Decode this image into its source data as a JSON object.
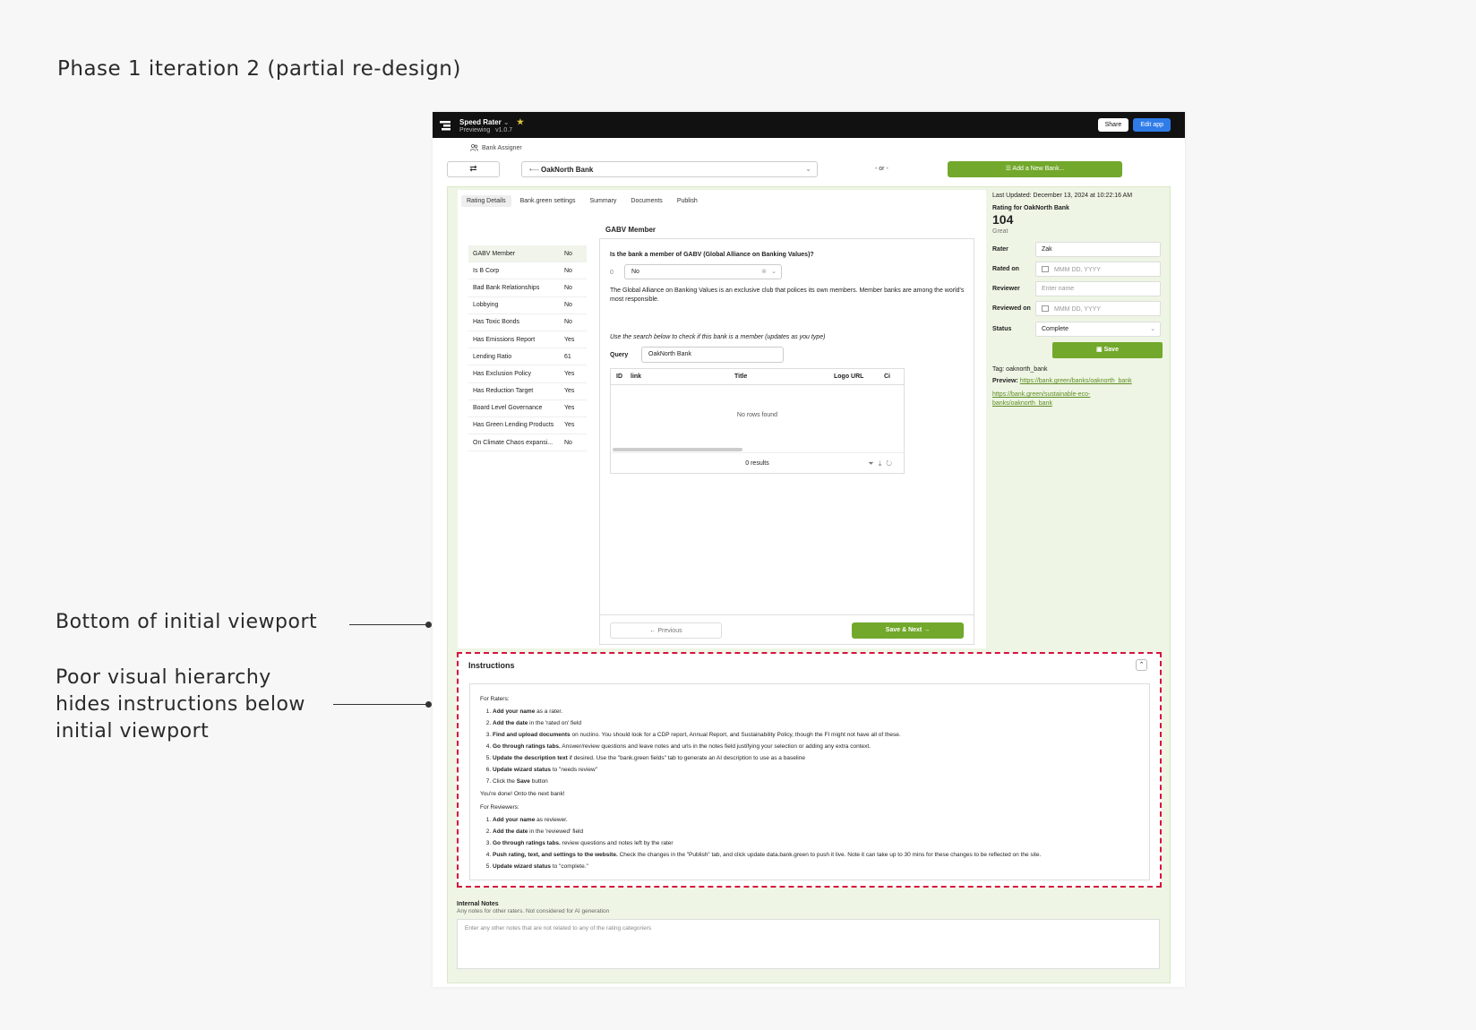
{
  "annotations": {
    "heading": "Phase 1 iteration 2 (partial re-design)",
    "viewport_note": "Bottom of initial viewport",
    "hierarchy_note_lines": [
      "Poor visual hierarchy",
      "hides instructions below",
      "initial viewport"
    ]
  },
  "topbar": {
    "app_name": "Speed Rater",
    "previewing": "Previewing",
    "version": "v1.0.7",
    "share_label": "Share",
    "edit_label": "Edit app"
  },
  "assigner_label": "Bank Assigner",
  "bank_row": {
    "selected_bank": "OakNorth Bank",
    "or_text": "- or -",
    "add_bank_label": "Add a New Bank..."
  },
  "tabs": [
    "Rating Details",
    "Bank.green settings",
    "Summary",
    "Documents",
    "Publish"
  ],
  "questions": [
    {
      "label": "GABV Member",
      "value": "No"
    },
    {
      "label": "Is B Corp",
      "value": "No"
    },
    {
      "label": "Bad Bank Relationships",
      "value": "No"
    },
    {
      "label": "Lobbying",
      "value": "No"
    },
    {
      "label": "Has Toxic Bonds",
      "value": "No"
    },
    {
      "label": "Has Emissions Report",
      "value": "Yes"
    },
    {
      "label": "Lending Ratio",
      "value": "61"
    },
    {
      "label": "Has Exclusion Policy",
      "value": "Yes"
    },
    {
      "label": "Has Reduction Target",
      "value": "Yes"
    },
    {
      "label": "Board Level Governance",
      "value": "Yes"
    },
    {
      "label": "Has Green Lending Products",
      "value": "Yes"
    },
    {
      "label": "On Climate Chaos expansi...",
      "value": "No"
    }
  ],
  "card": {
    "title": "GABV Member",
    "question": "Is the bank a member of GABV (Global Alliance on Banking Values)?",
    "score": "0",
    "answer": "No",
    "description": "The Global Alliance on Banking Values is an exclusive club that polices its own members. Member banks are among the world's most responsible.",
    "search_hint": "Use the search below to check if this bank is a member (updates as you type)",
    "query_label": "Query",
    "query_value": "OakNorth Bank",
    "table_columns": [
      "ID",
      "link",
      "Title",
      "Logo URL",
      "Ci"
    ],
    "empty_text": "No rows found",
    "results_text": "0 results",
    "prev_label": "Previous",
    "next_label": "Save & Next"
  },
  "rating": {
    "last_updated": "Last Updated: December 13, 2024 at 10:22:16 AM",
    "rating_for": "Rating for OakNorth Bank",
    "score": "104",
    "grade": "Great",
    "rater_label": "Rater",
    "rater_value": "Zak",
    "rated_on_label": "Rated on",
    "date_placeholder": "MMM DD, YYYY",
    "reviewer_label": "Reviewer",
    "reviewer_placeholder": "Enter name",
    "reviewed_on_label": "Reviewed on",
    "status_label": "Status",
    "status_value": "Complete",
    "save_label": "Save",
    "tag": "Tag: oaknorth_bank",
    "preview_label": "Preview:",
    "preview_link": "https://bank.green/banks/oaknorth_bank",
    "second_link": "https://bank.green/sustainable-eco-banks/oaknorth_bank"
  },
  "instructions": {
    "title": "Instructions",
    "raters_heading": "For Raters:",
    "raters_steps": [
      {
        "b": "Add your name",
        "t": " as a rater."
      },
      {
        "b": "Add the date",
        "t": " in the 'rated on' field"
      },
      {
        "b": "Find and upload documents",
        "t": " on nuclino. You should look for a CDP report, Annual Report, and Sustainability Policy, though the FI might not have all of these."
      },
      {
        "b": "Go through ratings tabs.",
        "t": " Answer/review questions and leave notes and urls in the notes field justifying your selection or adding any extra context."
      },
      {
        "b": "Update the description text",
        "t": " if desired. Use the \"bank.green fields\" tab to generate an AI description to use as a baseline"
      },
      {
        "b": "Update wizard status",
        "t": " to \"needs review\""
      },
      {
        "p": "Click the ",
        "b": "Save",
        "t": " button"
      }
    ],
    "done_text": "You're done! Onto the next bank!",
    "reviewers_heading": "For Reviewers:",
    "reviewers_steps": [
      {
        "b": "Add your name",
        "t": " as reviewer."
      },
      {
        "b": "Add the date",
        "t": " in the 'reviewed' field"
      },
      {
        "b": "Go through ratings tabs.",
        "t": " review questions and notes left by the rater"
      },
      {
        "b": "Push rating, text, and settings to the website.",
        "t": " Check the changes in the \"Publish\" tab, and click update data.bank.green to push it live. Note it can take up to 30 mins for these changes to be reflected on the site."
      },
      {
        "b": "Update wizard status",
        "t": " to \"complete.\""
      }
    ]
  },
  "notes": {
    "title": "Internal Notes",
    "subtitle": "Any notes for other raters. Not considered for AI generation",
    "placeholder": "Enter any other notes that are not related to any of the rating categoriers"
  }
}
